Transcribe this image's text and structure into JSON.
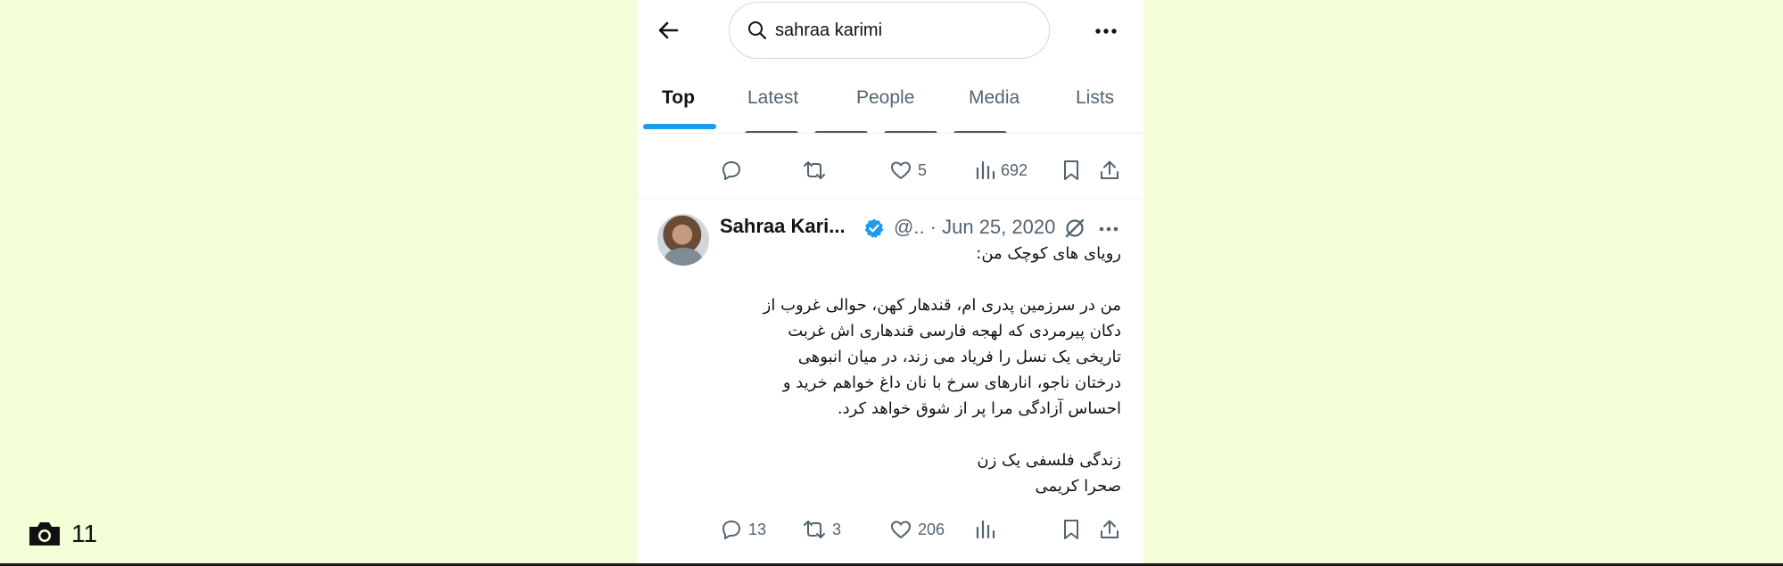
{
  "search": {
    "query": "sahraa karimi"
  },
  "tabs": [
    {
      "label": "Top"
    },
    {
      "label": "Latest"
    },
    {
      "label": "People"
    },
    {
      "label": "Media"
    },
    {
      "label": "Lists"
    }
  ],
  "prev_tweet": {
    "likes": "5",
    "views": "692"
  },
  "tweet": {
    "author_name": "Sahraa Kari...",
    "meta": "@.. · Jun 25, 2020",
    "lines": [
      "رویای های کوچک من:",
      "",
      "من در سرزمین پدری ام، قندهار کهن، حوالی غروب از",
      "دکان پیرمردی که لهجه فارسی قندهاری اش غربت",
      "تاریخی یک نسل را فریاد می زند، در میان انبوهی",
      "درختان ناجو، انارهای سرخ با نان داغ خواهم خرید و",
      "احساس آزادگی مرا پر از شوق خواهد کرد.",
      "",
      "زندگی فلسفی یک زن",
      "صحرا کریمی"
    ],
    "replies": "13",
    "reposts": "3",
    "likes": "206"
  },
  "overlay": {
    "photo_count": "11"
  },
  "colors": {
    "accent": "#1d9bf0",
    "background": "#f3fed6",
    "muted": "#536471"
  }
}
